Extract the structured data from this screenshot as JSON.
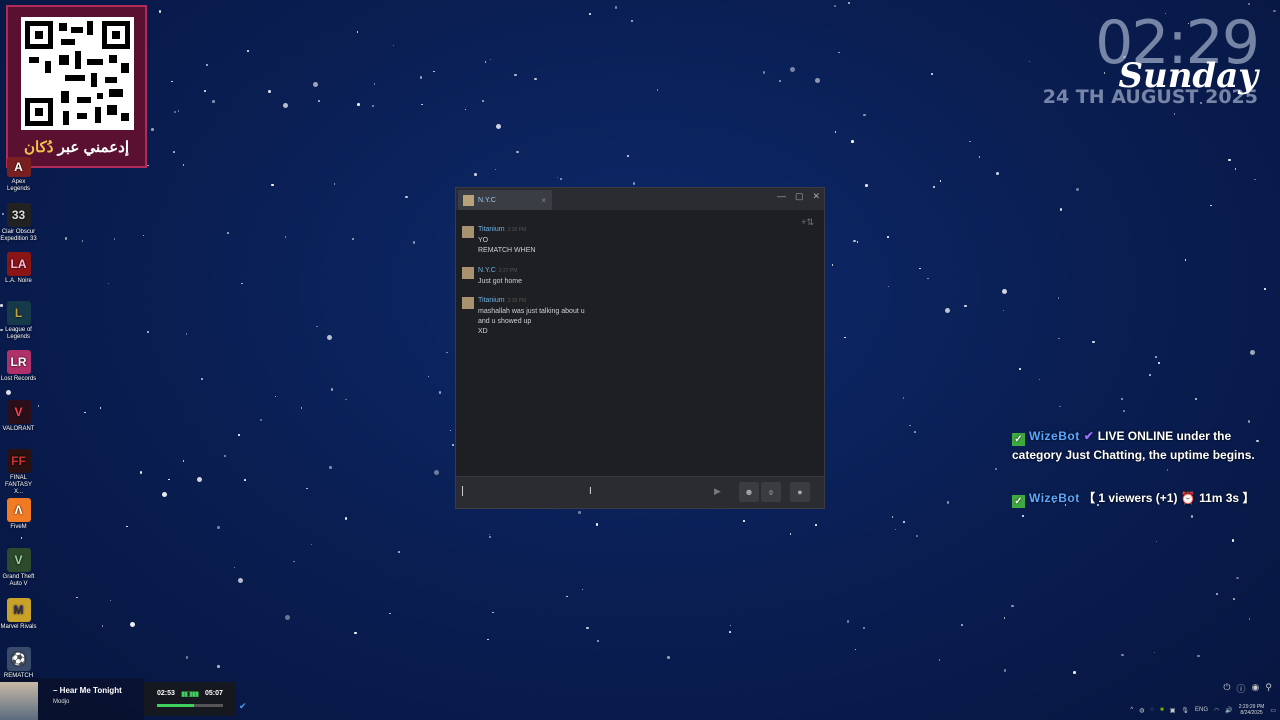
{
  "qr": {
    "caption_part1": "إدعمني عبر",
    "caption_part2": "دُكان"
  },
  "desktop_icons": [
    {
      "label": "Apex Legends",
      "glyph": "A"
    },
    {
      "label": "Clair Obscur Expedition 33",
      "glyph": "33"
    },
    {
      "label": "L.A. Noire",
      "glyph": "LA"
    },
    {
      "label": "League of Legends",
      "glyph": "L"
    },
    {
      "label": "Lost Records",
      "glyph": "LR"
    },
    {
      "label": "VALORANT",
      "glyph": "V"
    },
    {
      "label": "FINAL FANTASY X...",
      "glyph": "FF"
    },
    {
      "label": "FiveM",
      "glyph": "Λ"
    },
    {
      "label": "Grand Theft Auto V",
      "glyph": "V"
    },
    {
      "label": "Marvel Rivals",
      "glyph": "M"
    },
    {
      "label": "REMATCH",
      "glyph": "⚽"
    }
  ],
  "clock": {
    "time": "02:29",
    "day": "Sunday",
    "date": "24 TH AUGUST 2025"
  },
  "chat": {
    "tab_title": "N.Y.C",
    "messages": [
      {
        "name": "Titanium",
        "time": "2:26 PM",
        "lines": [
          "YO",
          "REMATCH WHEN"
        ]
      },
      {
        "name": "N.Y.C",
        "time": "2:27 PM",
        "lines": [
          "Just got home"
        ]
      },
      {
        "name": "Titanium",
        "time": "2:28 PM",
        "lines": [
          "mashallah was just talking about u",
          "and u showed up",
          "XD"
        ]
      }
    ],
    "input_value": "",
    "input_placeholder": ""
  },
  "wizebot": {
    "msg1": {
      "bot": "WizeBot",
      "text": "LIVE ONLINE under the category Just Chatting, the uptime begins."
    },
    "msg2": {
      "bot": "WizeBot",
      "text": "【 1 viewers (+1) ⏰ 11m 3s 】"
    }
  },
  "now_playing": {
    "title": "– Hear Me Tonight",
    "artist": "Modjo",
    "elapsed": "02:53",
    "duration": "05:07",
    "progress": 0.56
  },
  "tray": {
    "lang": "ENG",
    "time": "2:29:29 PM",
    "date": "8/24/2025"
  }
}
